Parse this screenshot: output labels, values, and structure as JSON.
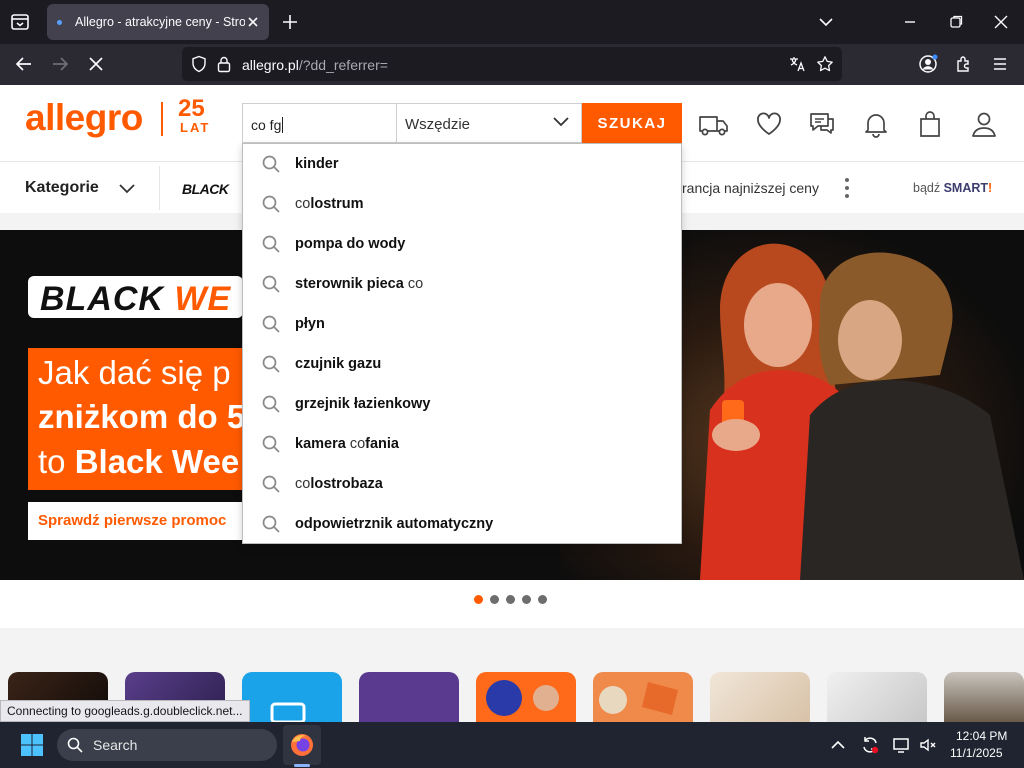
{
  "browser": {
    "tab_title": "Allegro - atrakcyjne ceny - Strona",
    "url_host": "allegro.pl",
    "url_path": "/?dd_referrer="
  },
  "header": {
    "logo": "allegro",
    "logo_anniversary_number": "25",
    "logo_anniversary_word": "LAT",
    "search_value": "co fg",
    "scope_value": "Wszędzie",
    "search_button": "SZUKAJ"
  },
  "categories": {
    "label": "Kategorie",
    "black_mini": "BLACK",
    "price_guarantee": "rancja najniższej ceny",
    "smart_prefix": "bądź ",
    "smart_word": "SMART",
    "smart_bang": "!"
  },
  "suggestions": [
    {
      "bold": "kinder",
      "normal": "",
      "parts": [
        [
          "b",
          "kinder"
        ]
      ]
    },
    {
      "parts": [
        [
          "n",
          "co"
        ],
        [
          "b",
          "lostrum"
        ]
      ]
    },
    {
      "parts": [
        [
          "b",
          "pompa do wody"
        ]
      ]
    },
    {
      "parts": [
        [
          "b",
          "sterownik pieca "
        ],
        [
          "n",
          "co"
        ]
      ]
    },
    {
      "parts": [
        [
          "b",
          "płyn"
        ]
      ]
    },
    {
      "parts": [
        [
          "b",
          "czujnik gazu"
        ]
      ]
    },
    {
      "parts": [
        [
          "b",
          "grzejnik łazienkowy"
        ]
      ]
    },
    {
      "parts": [
        [
          "b",
          "kamera "
        ],
        [
          "n",
          "co"
        ],
        [
          "b",
          "fania"
        ]
      ]
    },
    {
      "parts": [
        [
          "n",
          "co"
        ],
        [
          "b",
          "lostrobaza"
        ]
      ]
    },
    {
      "parts": [
        [
          "b",
          "odpowietrznik automatyczny"
        ]
      ]
    }
  ],
  "hero": {
    "badge_black": "BLACK ",
    "badge_week": "WE",
    "promo_line1": "Jak dać się p",
    "promo_line2": "zniżkom do 5",
    "promo_line3_prefix": "to ",
    "promo_line3_bold": "Black Wee",
    "cta": "Sprawdź pierwsze promoc",
    "dots": 5,
    "active_dot": 0
  },
  "status_bar": "Connecting to googleads.g.doubleclick.net...",
  "taskbar": {
    "search_label": "Search",
    "time": "12:04 PM",
    "date": "11/1/2025"
  },
  "colors": {
    "brand": "#ff5a00",
    "tab_bg": "#42414d",
    "taskbar": "#1f2430"
  }
}
